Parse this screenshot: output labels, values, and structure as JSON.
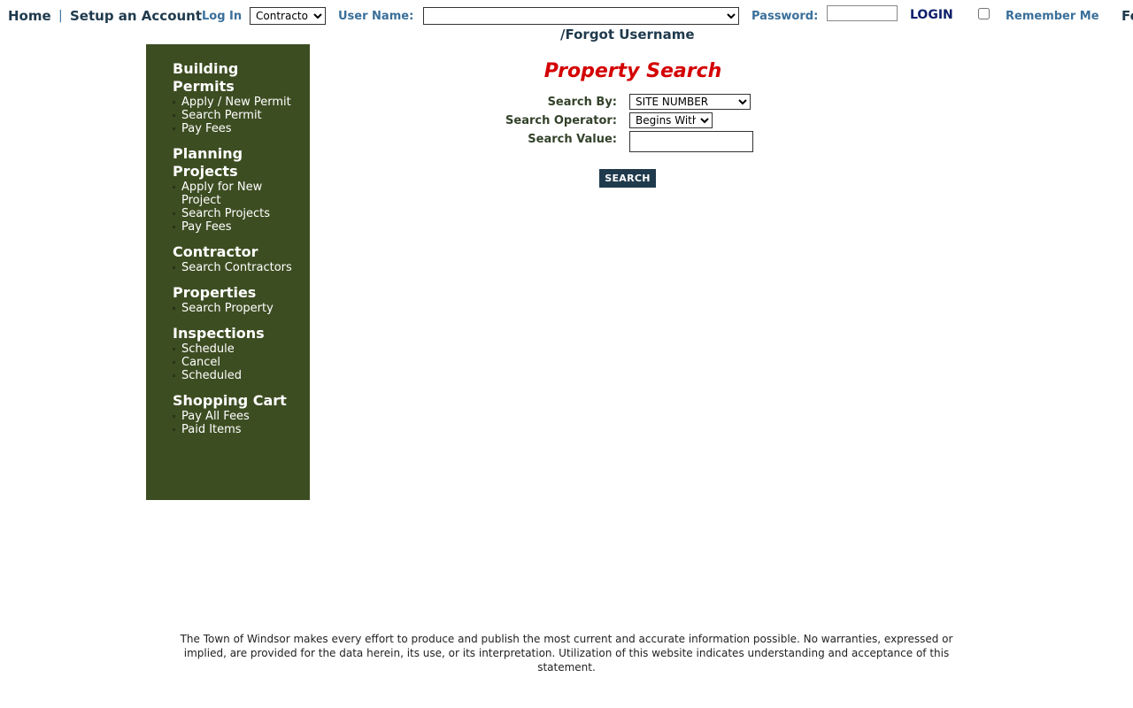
{
  "header": {
    "home": "Home",
    "separator": "|",
    "setup_account": "Setup an Account",
    "log_in": "Log In",
    "login_type": "Contractor",
    "user_name_label": "User Name:",
    "password_label": "Password:",
    "login_button": "LOGIN",
    "remember_me": "Remember Me",
    "forgot_prefix": "Fo",
    "forgot_username": "/Forgot Username"
  },
  "sidebar": {
    "sections": [
      {
        "heading": "Building Permits",
        "links": [
          "Apply / New Permit",
          "Search Permit",
          "Pay Fees"
        ]
      },
      {
        "heading": "Planning Projects",
        "links": [
          "Apply for New Project",
          "Search Projects",
          "Pay Fees"
        ]
      },
      {
        "heading": "Contractor",
        "links": [
          "Search Contractors"
        ]
      },
      {
        "heading": "Properties",
        "links": [
          "Search Property"
        ]
      },
      {
        "heading": "Inspections",
        "links": [
          "Schedule",
          "Cancel",
          "Scheduled"
        ]
      },
      {
        "heading": "Shopping Cart",
        "links": [
          "Pay All Fees",
          "Paid Items"
        ]
      }
    ]
  },
  "main": {
    "title": "Property Search",
    "search_by_label": "Search By:",
    "search_by_value": "SITE NUMBER",
    "search_operator_label": "Search Operator:",
    "search_operator_value": "Begins With",
    "search_value_label": "Search Value:",
    "search_value": "",
    "search_button": "SEARCH"
  },
  "footer": {
    "disclaimer": "The Town of Windsor makes every effort to produce and publish the most current and accurate information possible. No warranties, expressed or implied, are provided for the data herein, its use, or its interpretation. Utilization of this website indicates understanding and acceptance of this statement."
  },
  "colors": {
    "sidebar_bg": "#3d4d22",
    "title_red": "#d40000",
    "button_bg": "#1f3a4d",
    "link_blue": "#3a6f9a"
  }
}
